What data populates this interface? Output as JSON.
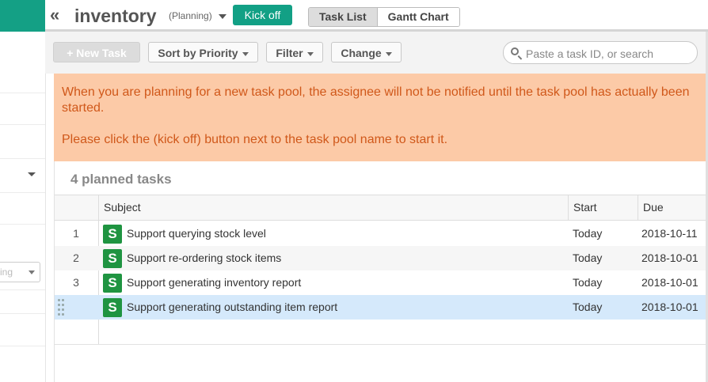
{
  "header": {
    "collapse_glyph": "«",
    "title": "inventory",
    "status": "(Planning)",
    "kickoff_label": "Kick off",
    "tabs": [
      {
        "label": "Task List",
        "active": true
      },
      {
        "label": "Gantt Chart",
        "active": false
      }
    ]
  },
  "sidebar": {
    "select_fragment": "ing"
  },
  "toolbar": {
    "new_task": "+ New Task",
    "sort": "Sort by Priority",
    "filter": "Filter",
    "change": "Change",
    "search_placeholder": "Paste a task ID, or search"
  },
  "notice": {
    "line1": "When you are planning for a new task pool, the assignee will not be notified until the task pool has actually been started.",
    "line2": "Please click the (kick off) button next to the task pool name to start it."
  },
  "tasks": {
    "count_label": "4 planned tasks",
    "columns": {
      "subject": "Subject",
      "start": "Start",
      "due": "Due"
    },
    "badge": "S",
    "rows": [
      {
        "num": "1",
        "subject": "Support querying stock level",
        "start": "Today",
        "due": "2018-10-11"
      },
      {
        "num": "2",
        "subject": "Support re-ordering stock items",
        "start": "Today",
        "due": "2018-10-01"
      },
      {
        "num": "3",
        "subject": "Support generating inventory report",
        "start": "Today",
        "due": "2018-10-01"
      },
      {
        "num": "",
        "subject": "Support generating outstanding item report",
        "start": "Today",
        "due": "2018-10-01"
      }
    ]
  },
  "colors": {
    "accent": "#12a085",
    "notice_bg": "#fccaa7",
    "notice_text": "#d0581a",
    "badge": "#1f9441",
    "selected_row": "#d5e9fb"
  }
}
